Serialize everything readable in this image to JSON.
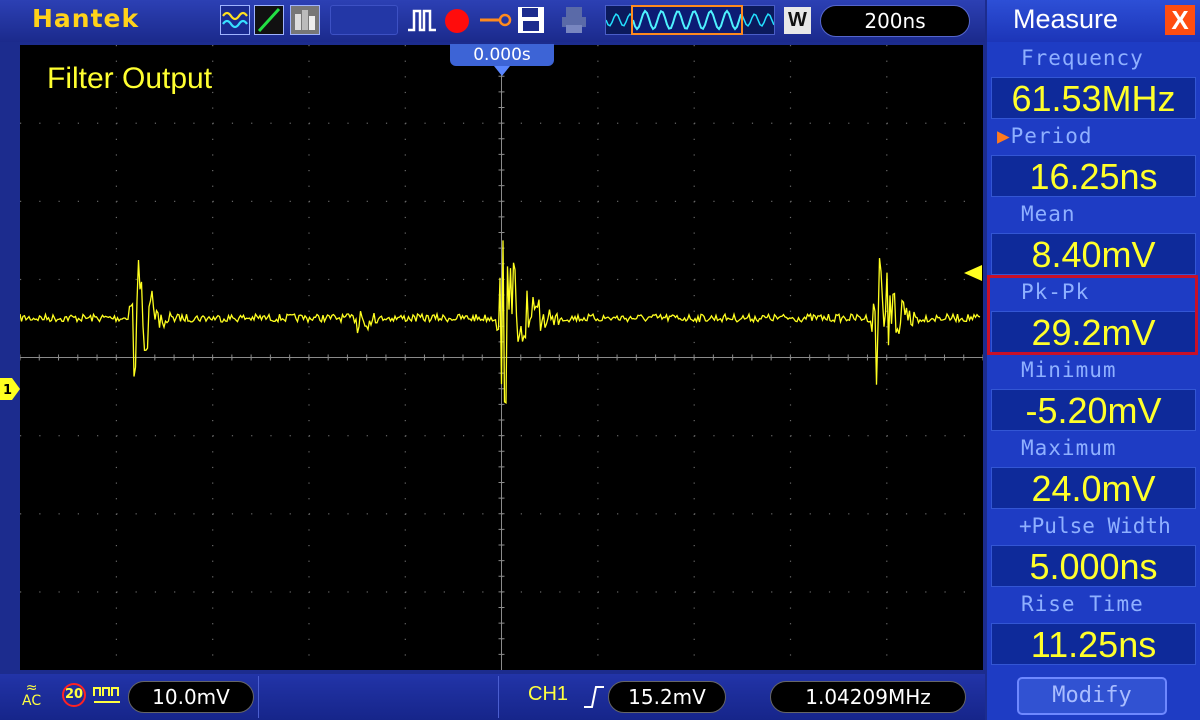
{
  "toolbar": {
    "brand": "Hantek",
    "icons": [
      "wave-mode-icon",
      "line-mode-icon",
      "persist-mode-icon",
      "pulse-icon",
      "record-icon",
      "reference-icon",
      "save-icon",
      "print-icon"
    ],
    "zoom_button": "W",
    "timebase": "200ns"
  },
  "screen": {
    "title": "Filter Output",
    "trigger_time": "0.000s",
    "channel_marker": "1",
    "trace_color": "#ffff20"
  },
  "measure": {
    "title": "Measure",
    "close_label": "X",
    "items": [
      {
        "label": "Frequency",
        "value": "61.53MHz"
      },
      {
        "label": "Period",
        "value": "16.25ns"
      },
      {
        "label": "Mean",
        "value": "8.40mV"
      },
      {
        "label": "Pk-Pk",
        "value": "29.2mV"
      },
      {
        "label": "Minimum",
        "value": "-5.20mV"
      },
      {
        "label": "Maximum",
        "value": "24.0mV"
      },
      {
        "label": "+Pulse Width",
        "value": "5.000ns"
      },
      {
        "label": "Rise Time",
        "value": "11.25ns"
      }
    ],
    "modify_label": "Modify",
    "highlight_color": "#c81028"
  },
  "status": {
    "coupling": "AC",
    "bandwidth_limit": "20",
    "volts_per_div": "10.0mV",
    "channel": "CH1",
    "trigger_level": "15.2mV",
    "trigger_frequency": "1.04209MHz"
  }
}
